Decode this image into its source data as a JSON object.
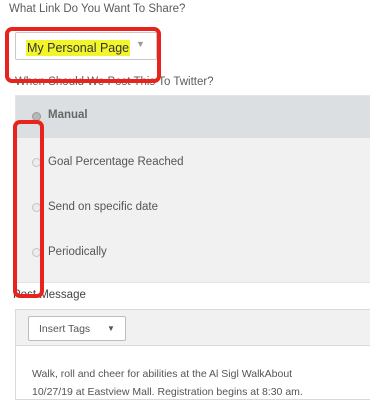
{
  "link_question": "What Link Do You Want To Share?",
  "link_select": {
    "value": "My Personal Page",
    "caret": "▼"
  },
  "post_question": "When Should We Post This To Twitter?",
  "schedule_options": [
    {
      "label": "Manual",
      "selected": true
    },
    {
      "label": "Goal Percentage Reached",
      "selected": false
    },
    {
      "label": "Send on specific date",
      "selected": false
    },
    {
      "label": "Periodically",
      "selected": false
    }
  ],
  "post_message": {
    "label": "Post Message",
    "insert_tags_label": "Insert Tags",
    "insert_tags_caret": "▼",
    "body_lines": [
      "Walk, roll and cheer for abilities at the Al Sigl WalkAbout",
      "10/27/19 at Eastview Mall.  Registration begins at 8:30 am."
    ]
  },
  "colors": {
    "highlight": "#f3f52b",
    "annotation": "#e8231d",
    "panel": "#f1f1f1"
  }
}
